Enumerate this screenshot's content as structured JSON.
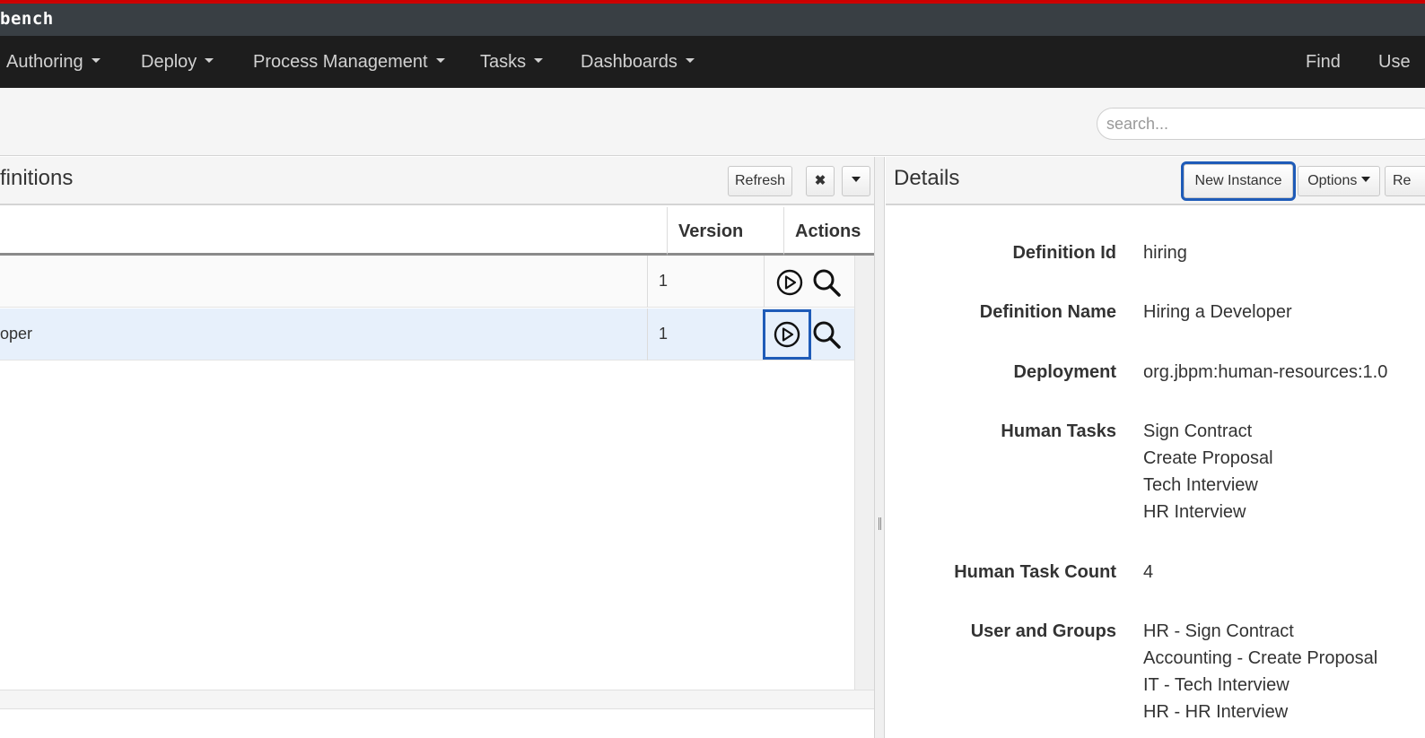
{
  "app": {
    "title": "bench"
  },
  "nav": {
    "items": [
      {
        "label": "Authoring"
      },
      {
        "label": "Deploy"
      },
      {
        "label": "Process Management"
      },
      {
        "label": "Tasks"
      },
      {
        "label": "Dashboards"
      }
    ],
    "right": [
      {
        "label": "Find"
      },
      {
        "label": "Use"
      }
    ]
  },
  "search": {
    "placeholder": "search..."
  },
  "definitions": {
    "title": "finitions",
    "refresh_label": "Refresh",
    "close_glyph": "✖",
    "columns": {
      "version": "Version",
      "actions": "Actions"
    },
    "rows": [
      {
        "name": "",
        "version": "1",
        "selected": false
      },
      {
        "name": "oper",
        "version": "1",
        "selected": true
      }
    ]
  },
  "details": {
    "title": "Details",
    "new_instance_label": "New Instance",
    "options_label": "Options",
    "refresh_label": "Re",
    "fields": {
      "definition_id": {
        "label": "Definition Id",
        "value": "hiring"
      },
      "definition_name": {
        "label": "Definition Name",
        "value": "Hiring a Developer"
      },
      "deployment": {
        "label": "Deployment",
        "value": "org.jbpm:human-resources:1.0"
      },
      "human_tasks": {
        "label": "Human Tasks",
        "values": [
          "Sign Contract",
          "Create Proposal",
          "Tech Interview",
          "HR Interview"
        ]
      },
      "human_task_count": {
        "label": "Human Task Count",
        "value": "4"
      },
      "user_and_groups": {
        "label": "User and Groups",
        "values": [
          "HR - Sign Contract",
          "Accounting - Create Proposal",
          "IT - Tech Interview",
          "HR - HR Interview"
        ]
      }
    }
  },
  "colors": {
    "accent": "#cc0000",
    "focus": "#1e5bb8",
    "selected_row": "#e7f0fb"
  }
}
